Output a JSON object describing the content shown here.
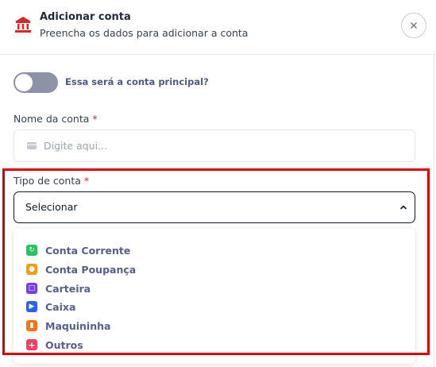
{
  "header": {
    "title": "Adicionar conta",
    "subtitle": "Preencha os dados para adicionar a conta",
    "icon": "bank-icon",
    "icon_color": "#dc2626",
    "close_icon": "close-icon"
  },
  "toggle": {
    "label": "Essa será a conta principal?",
    "checked": false
  },
  "name_field": {
    "label": "Nome da conta",
    "required_mark": "*",
    "placeholder": "Digite aqui...",
    "icon": "card-icon"
  },
  "type_field": {
    "label": "Tipo de conta",
    "required_mark": "*",
    "selected": "Selecionar",
    "icon": "chevron-up-icon",
    "options": [
      {
        "label": "Conta Corrente",
        "icon": "checking-icon",
        "color": "#22c55e"
      },
      {
        "label": "Conta Poupança",
        "icon": "piggy-bank-icon",
        "color": "#f59e0b"
      },
      {
        "label": "Carteira",
        "icon": "wallet-icon",
        "color": "#7c3aed"
      },
      {
        "label": "Caixa",
        "icon": "cash-icon",
        "color": "#2563eb"
      },
      {
        "label": "Maquininha",
        "icon": "card-machine-icon",
        "color": "#f97316"
      },
      {
        "label": "Outros",
        "icon": "plus-icon",
        "color": "#f43f5e"
      }
    ]
  },
  "colors": {
    "highlight": "#e00000",
    "option_text": "#55608a",
    "toggle_off": "#8e92a6"
  }
}
